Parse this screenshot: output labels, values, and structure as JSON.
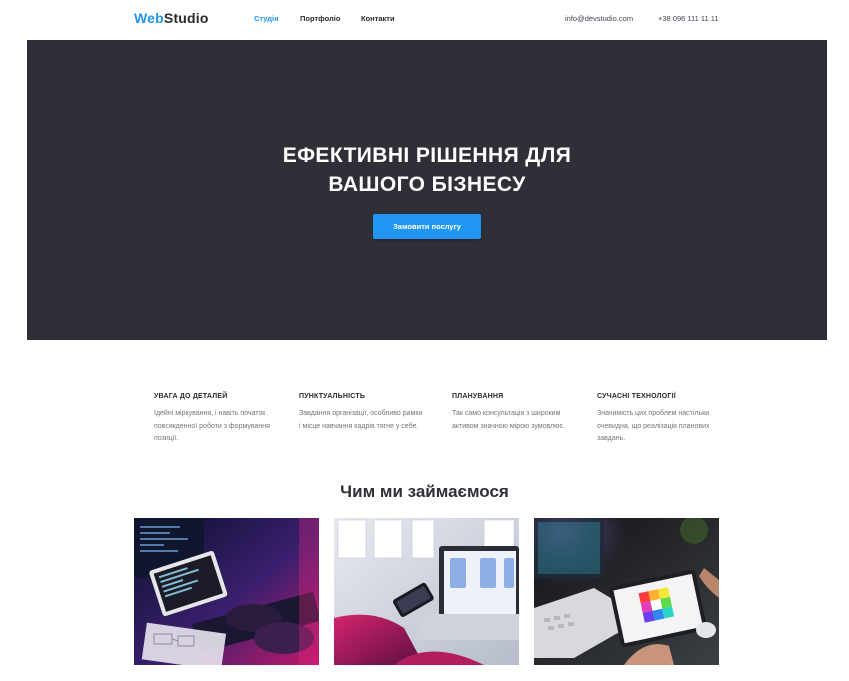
{
  "header": {
    "logo_part1": "Web",
    "logo_part2": "Studio",
    "nav": [
      "Студія",
      "Портфоліо",
      "Контакти"
    ],
    "email": "info@devstudio.com",
    "phone": "+38 096 111 11 11"
  },
  "hero": {
    "title_line1": "ЕФЕКТИВНІ РІШЕННЯ ДЛЯ",
    "title_line2": "ВАШОГО БІЗНЕСУ",
    "button_label": "Замовити послугу"
  },
  "features": [
    {
      "title": "УВАГА ДО ДЕТАЛЕЙ",
      "lines": [
        "Ідейні міркування, і навіть початок",
        "повсякденної роботи з формування",
        "позиції."
      ]
    },
    {
      "title": "ПУНКТУАЛЬНІСТЬ",
      "lines": [
        "Завдання організації, особливо рамки",
        "і місце навчання кадрів тягне у себе."
      ]
    },
    {
      "title": "ПЛАНУВАННЯ",
      "lines": [
        "Так само консультація з широким",
        "активом значною мірою зумовлює."
      ]
    },
    {
      "title": "СУЧАСНІ ТЕХНОЛОГІЇ",
      "lines": [
        "Значимість цих проблем настільки",
        "очевидна, що реалізація планових",
        "завдань."
      ]
    }
  ],
  "section": {
    "title": "Чим ми займаємося"
  },
  "colors": {
    "accent": "#2196f3",
    "hero_bg": "#2f2f37",
    "text_dark": "#2a2a2a",
    "text_muted": "#757575"
  }
}
